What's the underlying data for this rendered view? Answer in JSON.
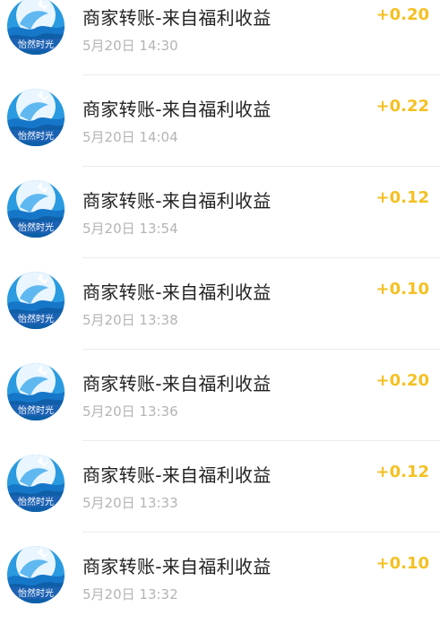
{
  "avatar_icon": "yiranshiguang-logo",
  "avatar_text": "怡然时光",
  "colors": {
    "amount": "#f5c021",
    "title": "#222222",
    "time": "#b4b4b4",
    "avatar_blue": "#2a9be0"
  },
  "transactions": [
    {
      "title": "商家转账-来自福利收益",
      "time": "5月20日 14:30",
      "amount": "+0.20"
    },
    {
      "title": "商家转账-来自福利收益",
      "time": "5月20日 14:04",
      "amount": "+0.22"
    },
    {
      "title": "商家转账-来自福利收益",
      "time": "5月20日 13:54",
      "amount": "+0.12"
    },
    {
      "title": "商家转账-来自福利收益",
      "time": "5月20日 13:38",
      "amount": "+0.10"
    },
    {
      "title": "商家转账-来自福利收益",
      "time": "5月20日 13:36",
      "amount": "+0.20"
    },
    {
      "title": "商家转账-来自福利收益",
      "time": "5月20日 13:33",
      "amount": "+0.12"
    },
    {
      "title": "商家转账-来自福利收益",
      "time": "5月20日 13:32",
      "amount": "+0.10"
    }
  ]
}
